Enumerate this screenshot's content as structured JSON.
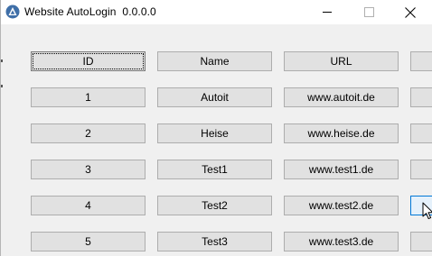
{
  "window": {
    "title": "Website AutoLogin  0.0.0.0",
    "icon": "autoit-icon",
    "controls": [
      "minimize",
      "maximize",
      "close"
    ]
  },
  "headers": {
    "id": "ID",
    "name": "Name",
    "url": "URL",
    "extra": ""
  },
  "rows": [
    {
      "id": "1",
      "name": "Autoit",
      "url": "www.autoit.de",
      "extra": ""
    },
    {
      "id": "2",
      "name": "Heise",
      "url": "www.heise.de",
      "extra": ""
    },
    {
      "id": "3",
      "name": "Test1",
      "url": "www.test1.de",
      "extra": ""
    },
    {
      "id": "4",
      "name": "Test2",
      "url": "www.test2.de",
      "extra": ""
    },
    {
      "id": "5",
      "name": "Test3",
      "url": "www.test3.de",
      "extra": ""
    }
  ],
  "colors": {
    "button_face": "#e1e1e1",
    "button_border": "#adadad",
    "hover_border": "#0078d7",
    "window_bg": "#f0f0f0"
  }
}
